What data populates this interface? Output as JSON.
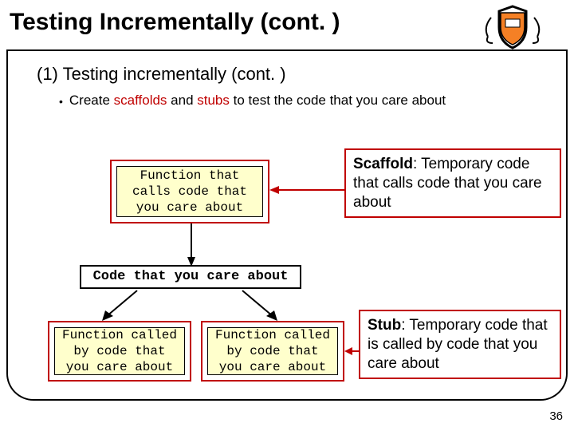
{
  "title": "Testing Incrementally (cont. )",
  "subtitle": "(1) Testing incrementally (cont. )",
  "bullet": {
    "pre": "Create ",
    "kw1": "scaffolds",
    "mid": " and ",
    "kw2": "stubs",
    "post": " to test the code that you care about"
  },
  "boxes": {
    "scaffold_caller": "Function that\ncalls code that\nyou care about",
    "code_care": "Code that you care about",
    "called1": "Function called\nby code that\nyou care about",
    "called2": "Function called\nby code that\nyou care about"
  },
  "annotations": {
    "scaffold_label": "Scaffold",
    "scaffold_text": ": Temporary code that calls code that you care about",
    "stub_label": "Stub",
    "stub_text": ": Temporary code that is called by code that you care about"
  },
  "pagenum": "36"
}
